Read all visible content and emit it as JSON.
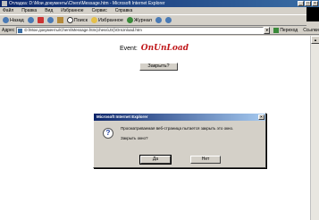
{
  "window": {
    "title": "Отладка: D:\\Мои документы\\Chers\\Message.htm - Microsoft Internet Explorer",
    "controls": [
      "_",
      "□",
      "×"
    ]
  },
  "menubar": [
    "Файл",
    "Правка",
    "Вид",
    "Избранное",
    "Сервис",
    "Справка"
  ],
  "toolbar": {
    "back": "Назад",
    "search": "Поиск",
    "favorites": "Избранное",
    "journal": "Журнал"
  },
  "address": {
    "label": "Адрес",
    "value": "D:\\Мои документы\\Chers\\Message.htm(chess\\JS)\\OnUnload.htm",
    "go": "Переход",
    "links": "Ссылки"
  },
  "page": {
    "heading_label": "Event",
    "heading_event": "OnUnLoad",
    "close_button": "Закрыть?"
  },
  "dialog": {
    "title": "Microsoft Internet Explorer",
    "close": "×",
    "message": "Просматриваемая веб-страница пытается закрыть это окно.",
    "question": "Закрыть окно?",
    "yes": "Да",
    "no": "Нет"
  },
  "scrollbar": {
    "up": "▲"
  }
}
